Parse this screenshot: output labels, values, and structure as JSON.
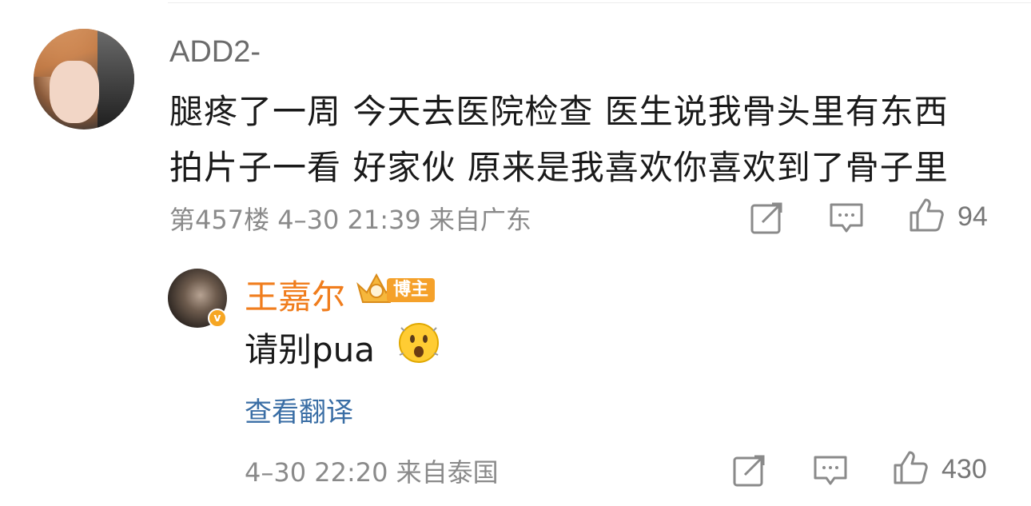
{
  "comment": {
    "username": "ADD2-",
    "text_line1": "腿疼了一周 今天去医院检查 医生说我骨头里有东西",
    "text_line2": "拍片子一看 好家伙 原来是我喜欢你喜欢到了骨子里",
    "meta": "第457楼 4–30 21:39 来自广东",
    "likes": "94"
  },
  "reply": {
    "username": "王嘉尔",
    "badge": "博主",
    "verified_mark": "v",
    "text": "请别pua",
    "translate_label": "查看翻译",
    "meta": "4–30 22:20 来自泰国",
    "likes": "430"
  },
  "icons": {
    "share": "share-icon",
    "comment": "comment-icon",
    "like": "like-icon",
    "emoji": "surprised-emoji-icon",
    "crown": "crown-icon"
  },
  "colors": {
    "accent_orange": "#f07d1d",
    "link_blue": "#3a6ea5",
    "meta_gray": "#8a8a8a"
  }
}
